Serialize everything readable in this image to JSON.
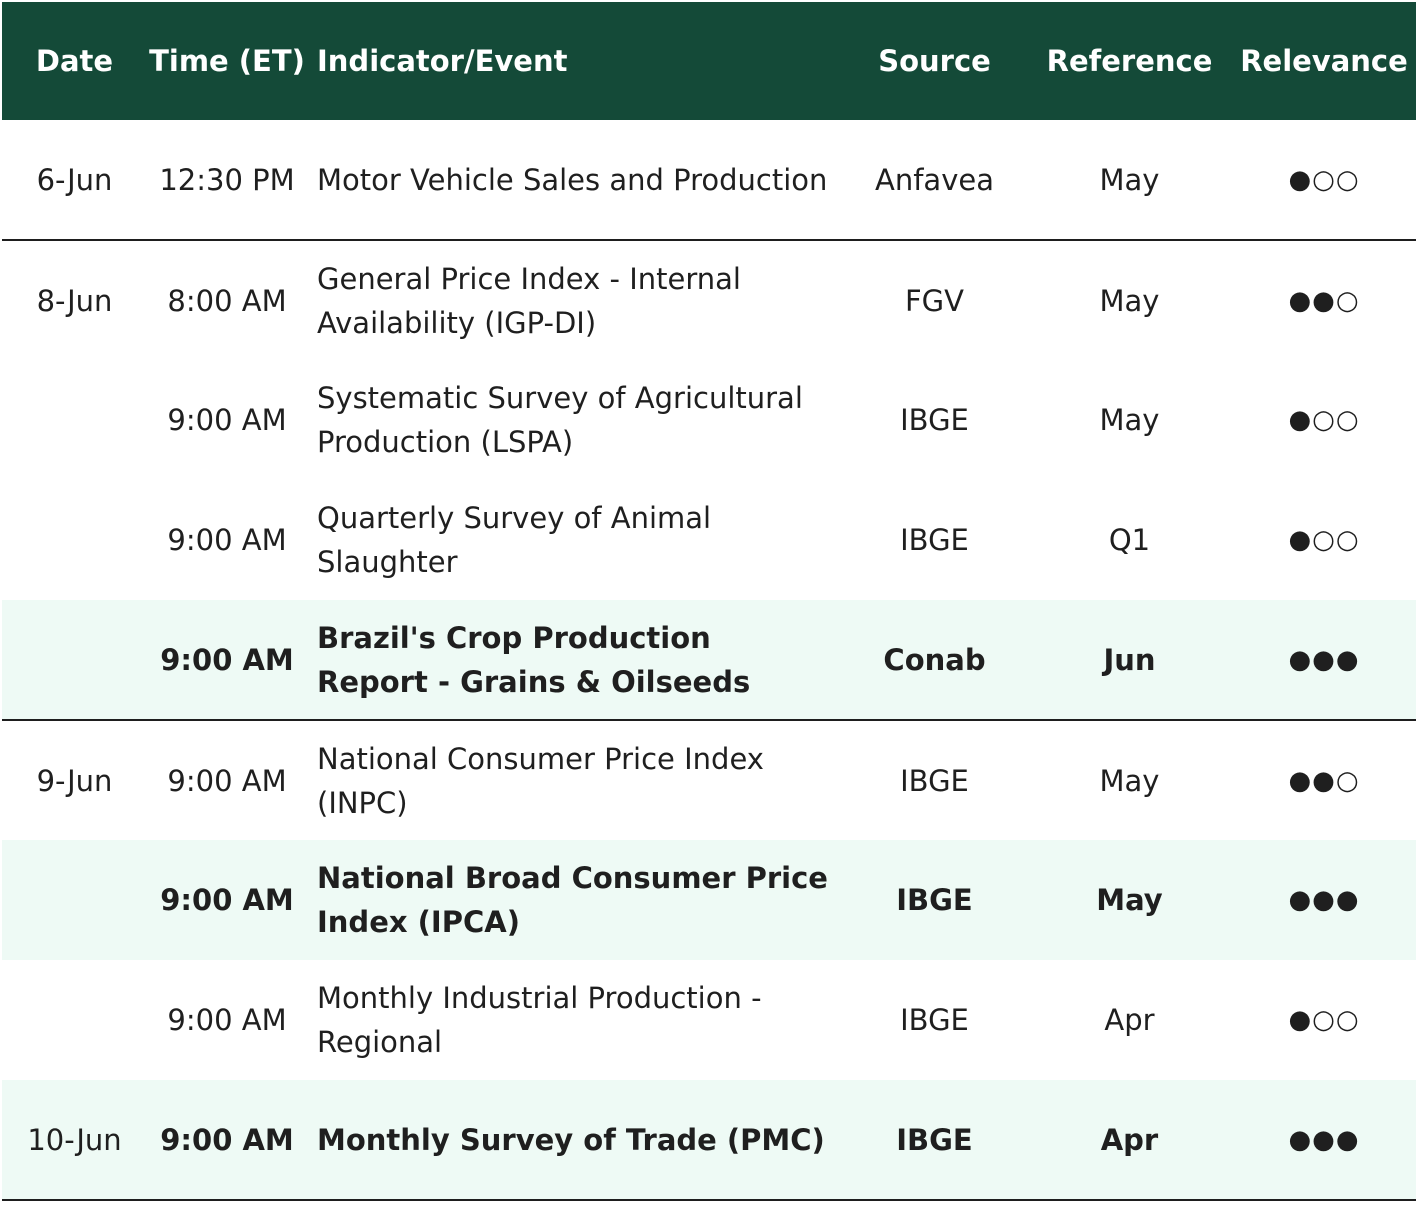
{
  "headers": {
    "date": "Date",
    "time": "Time (ET)",
    "indicator": "Indicator/Event",
    "source": "Source",
    "reference": "Reference",
    "relevance": "Relevance"
  },
  "rows": [
    {
      "date": "6-Jun",
      "time": "12:30 PM",
      "indicator": "Motor Vehicle Sales and Production",
      "source": "Anfavea",
      "reference": "May",
      "relevance": "●○○"
    },
    {
      "date": "8-Jun",
      "time": "8:00 AM",
      "indicator": "General Price Index - Internal Availability (IGP-DI)",
      "source": "FGV",
      "reference": "May",
      "relevance": "●●○"
    },
    {
      "date": "",
      "time": "9:00 AM",
      "indicator": "Systematic Survey of Agricultural Production (LSPA)",
      "source": "IBGE",
      "reference": "May",
      "relevance": "●○○"
    },
    {
      "date": "",
      "time": "9:00 AM",
      "indicator": "Quarterly Survey of Animal Slaughter",
      "source": "IBGE",
      "reference": "Q1",
      "relevance": "●○○"
    },
    {
      "date": "",
      "time": "9:00 AM",
      "indicator": "Brazil's Crop Production Report - Grains & Oilseeds",
      "source": "Conab",
      "reference": "Jun",
      "relevance": "●●●"
    },
    {
      "date": "9-Jun",
      "time": "9:00 AM",
      "indicator": "National Consumer Price Index (INPC)",
      "source": "IBGE",
      "reference": "May",
      "relevance": "●●○"
    },
    {
      "date": "",
      "time": "9:00 AM",
      "indicator": "National Broad Consumer Price Index (IPCA)",
      "source": "IBGE",
      "reference": "May",
      "relevance": "●●●"
    },
    {
      "date": "",
      "time": "9:00 AM",
      "indicator": "Monthly Industrial Production - Regional",
      "source": "IBGE",
      "reference": "Apr",
      "relevance": "●○○"
    },
    {
      "date": "10-Jun",
      "time": "9:00 AM",
      "indicator": "Monthly Survey of Trade (PMC)",
      "source": "IBGE",
      "reference": "Apr",
      "relevance": "●●●"
    }
  ]
}
